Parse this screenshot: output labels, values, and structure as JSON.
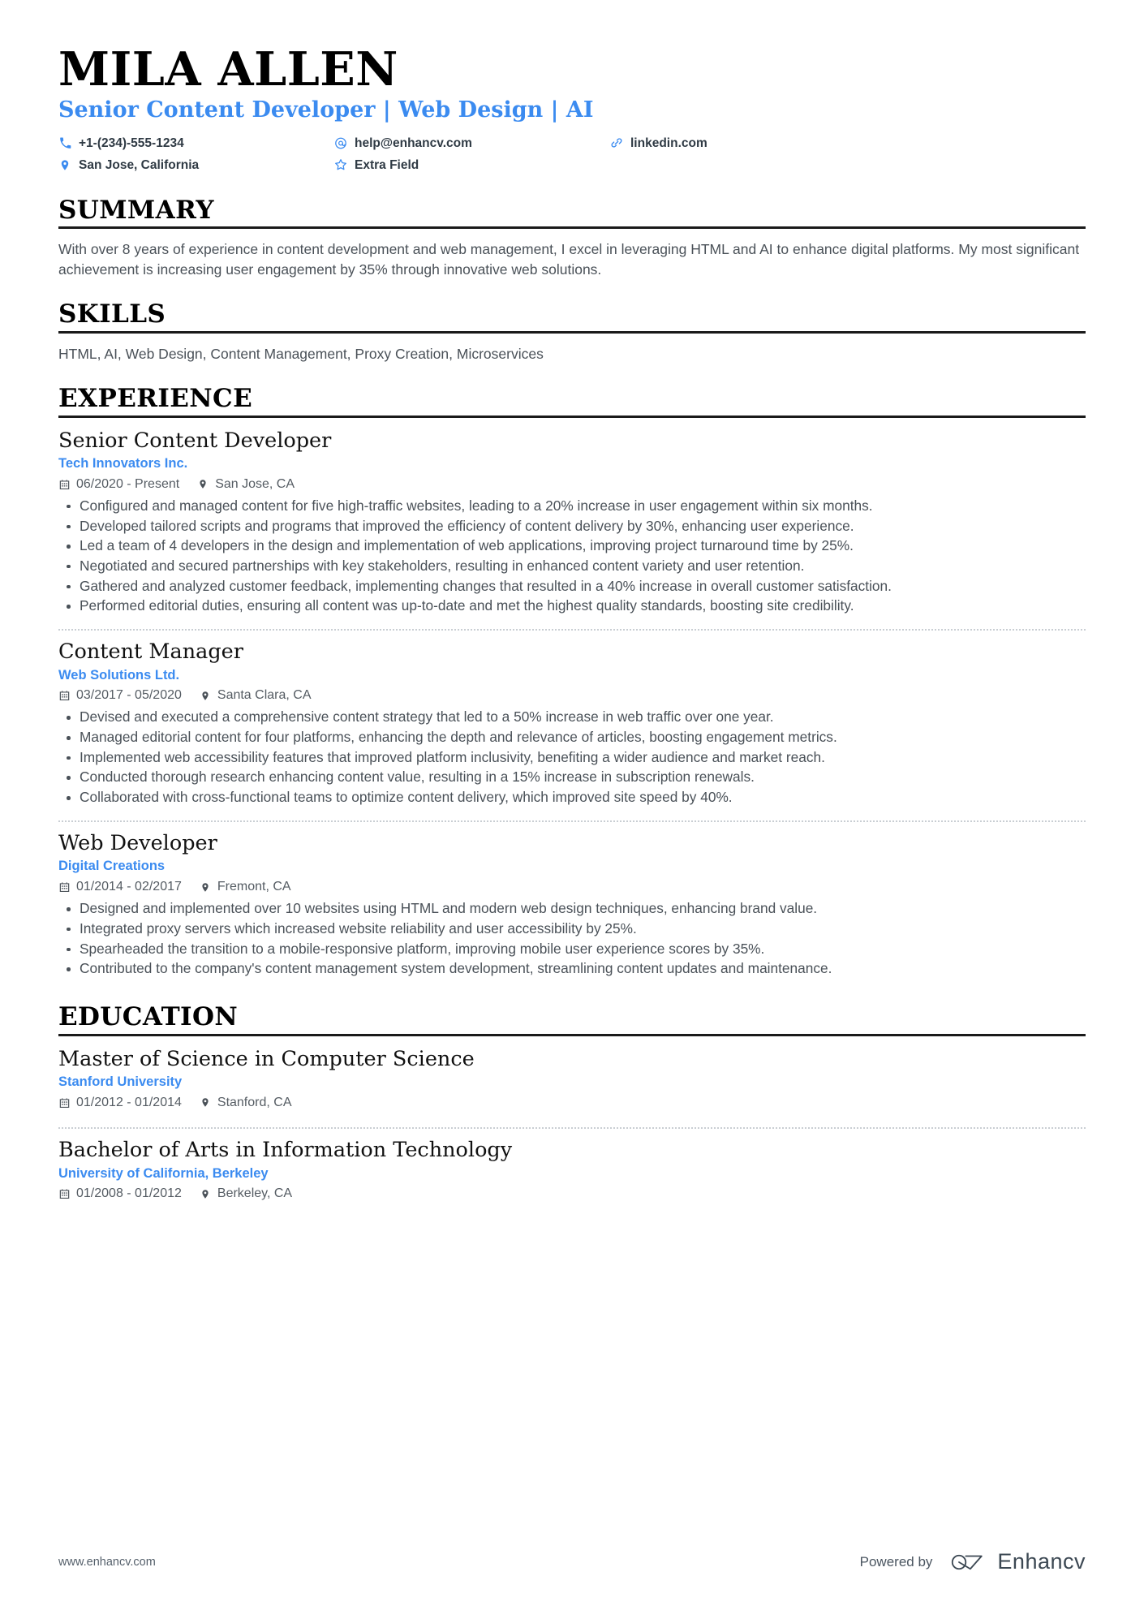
{
  "header": {
    "name": "MILA ALLEN",
    "headline": "Senior Content Developer | Web Design | AI",
    "contacts": [
      {
        "icon": "phone-icon",
        "text": "+1-(234)-555-1234"
      },
      {
        "icon": "email-icon",
        "text": "help@enhancv.com"
      },
      {
        "icon": "link-icon",
        "text": "linkedin.com"
      },
      {
        "icon": "location-icon",
        "text": "San Jose, California"
      },
      {
        "icon": "star-icon",
        "text": "Extra Field"
      }
    ]
  },
  "sections": {
    "summary": {
      "title": "SUMMARY",
      "text": "With over 8 years of experience in content development and web management, I excel in leveraging HTML and AI to enhance digital platforms. My most significant achievement is increasing user engagement by 35% through innovative web solutions."
    },
    "skills": {
      "title": "SKILLS",
      "text": "HTML, AI, Web Design, Content Management, Proxy Creation, Microservices"
    },
    "experience": {
      "title": "EXPERIENCE",
      "entries": [
        {
          "title": "Senior Content Developer",
          "org": "Tech Innovators Inc.",
          "date": "06/2020 - Present",
          "location": "San Jose, CA",
          "bullets": [
            "Configured and managed content for five high-traffic websites, leading to a 20% increase in user engagement within six months.",
            "Developed tailored scripts and programs that improved the efficiency of content delivery by 30%, enhancing user experience.",
            "Led a team of 4 developers in the design and implementation of web applications, improving project turnaround time by 25%.",
            "Negotiated and secured partnerships with key stakeholders, resulting in enhanced content variety and user retention.",
            "Gathered and analyzed customer feedback, implementing changes that resulted in a 40% increase in overall customer satisfaction.",
            "Performed editorial duties, ensuring all content was up-to-date and met the highest quality standards, boosting site credibility."
          ]
        },
        {
          "title": "Content Manager",
          "org": "Web Solutions Ltd.",
          "date": "03/2017 - 05/2020",
          "location": "Santa Clara, CA",
          "bullets": [
            "Devised and executed a comprehensive content strategy that led to a 50% increase in web traffic over one year.",
            "Managed editorial content for four platforms, enhancing the depth and relevance of articles, boosting engagement metrics.",
            "Implemented web accessibility features that improved platform inclusivity, benefiting a wider audience and market reach.",
            "Conducted thorough research enhancing content value, resulting in a 15% increase in subscription renewals.",
            "Collaborated with cross-functional teams to optimize content delivery, which improved site speed by 40%."
          ]
        },
        {
          "title": "Web Developer",
          "org": "Digital Creations",
          "date": "01/2014 - 02/2017",
          "location": "Fremont, CA",
          "bullets": [
            "Designed and implemented over 10 websites using HTML and modern web design techniques, enhancing brand value.",
            "Integrated proxy servers which increased website reliability and user accessibility by 25%.",
            "Spearheaded the transition to a mobile-responsive platform, improving mobile user experience scores by 35%.",
            "Contributed to the company's content management system development, streamlining content updates and maintenance."
          ]
        }
      ]
    },
    "education": {
      "title": "EDUCATION",
      "entries": [
        {
          "title": "Master of Science in Computer Science",
          "org": "Stanford University",
          "date": "01/2012 - 01/2014",
          "location": "Stanford, CA"
        },
        {
          "title": "Bachelor of Arts in Information Technology",
          "org": "University of California, Berkeley",
          "date": "01/2008 - 01/2012",
          "location": "Berkeley, CA"
        }
      ]
    }
  },
  "footer": {
    "url": "www.enhancv.com",
    "powered_by": "Powered by",
    "brand": "Enhancv"
  },
  "colors": {
    "accent": "#3b8bf0",
    "text": "#4a5158",
    "heading": "#000000"
  }
}
